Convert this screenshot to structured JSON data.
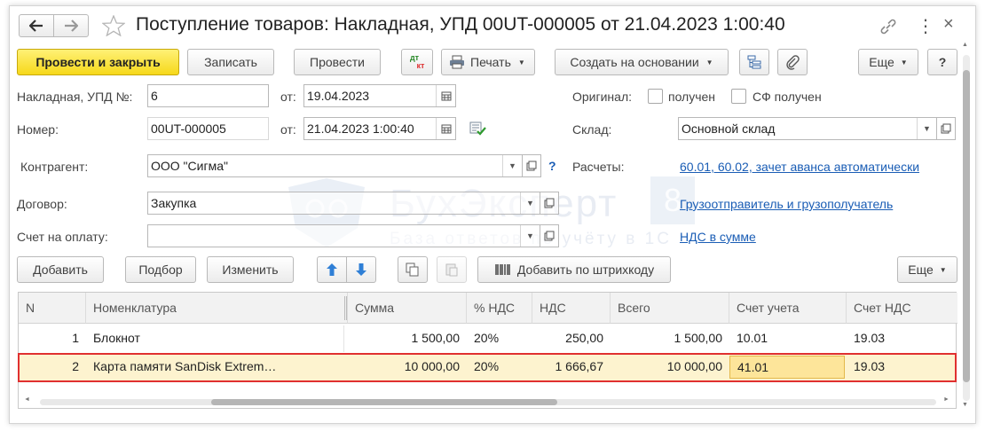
{
  "window": {
    "title": "Поступление товаров: Накладная, УПД 00UT-000005 от 21.04.2023 1:00:40",
    "more_icon": "⋮",
    "close_icon": "×"
  },
  "toolbar": {
    "post_close": "Провести и закрыть",
    "save": "Записать",
    "post": "Провести",
    "dt_kt_top": "дт",
    "dt_kt_bottom": "кт",
    "print": "Печать",
    "create_based": "Создать на основании",
    "more": "Еще",
    "help": "?"
  },
  "form": {
    "invoice_label": "Накладная, УПД №:",
    "invoice_value": "6",
    "from_label": "от:",
    "invoice_date": "19.04.2023",
    "number_label": "Номер:",
    "number_value": "00UT-000005",
    "from_label2": "от:",
    "number_date": "21.04.2023  1:00:40",
    "original_label": "Оригинал:",
    "received_label": "получен",
    "sf_received_label": "СФ получен",
    "warehouse_label": "Склад:",
    "warehouse_value": "Основной склад",
    "counterparty_label": "Контрагент:",
    "counterparty_value": "ООО \"Сигма\"",
    "help_q": "?",
    "settlements_label": "Расчеты:",
    "settlements_link": "60.01, 60.02, зачет аванса автоматически",
    "contract_label": "Договор:",
    "contract_value": "Закупка",
    "shipper_link": "Грузоотправитель и грузополучатель",
    "payment_account_label": "Счет на оплату:",
    "payment_account_value": "",
    "vat_link": "НДС в сумме"
  },
  "table_toolbar": {
    "add": "Добавить",
    "select": "Подбор",
    "edit": "Изменить",
    "add_barcode": "Добавить по штрихкоду",
    "more": "Еще"
  },
  "table": {
    "headers": [
      "N",
      "Номенклатура",
      "Сумма",
      "% НДС",
      "НДС",
      "Всего",
      "Счет учета",
      "Счет НДС"
    ],
    "rows": [
      {
        "n": "1",
        "item": "Блокнот",
        "sum": "1 500,00",
        "vat_rate": "20%",
        "vat": "250,00",
        "total": "1 500,00",
        "account": "10.01",
        "vat_account": "19.03"
      },
      {
        "n": "2",
        "item": "Карта памяти SanDisk Extrem…",
        "sum": "10 000,00",
        "vat_rate": "20%",
        "vat": "1 666,67",
        "total": "10 000,00",
        "account": "41.01",
        "vat_account": "19.03"
      }
    ]
  },
  "watermark": {
    "brand": "БухЭксперт",
    "digit": "8",
    "tagline": "База ответов по учёту в 1С"
  },
  "colors": {
    "primary_button": "#f6d81a",
    "selected_row": "#fdf3cf",
    "highlight_border": "#e03030",
    "link": "#1a5db5"
  }
}
